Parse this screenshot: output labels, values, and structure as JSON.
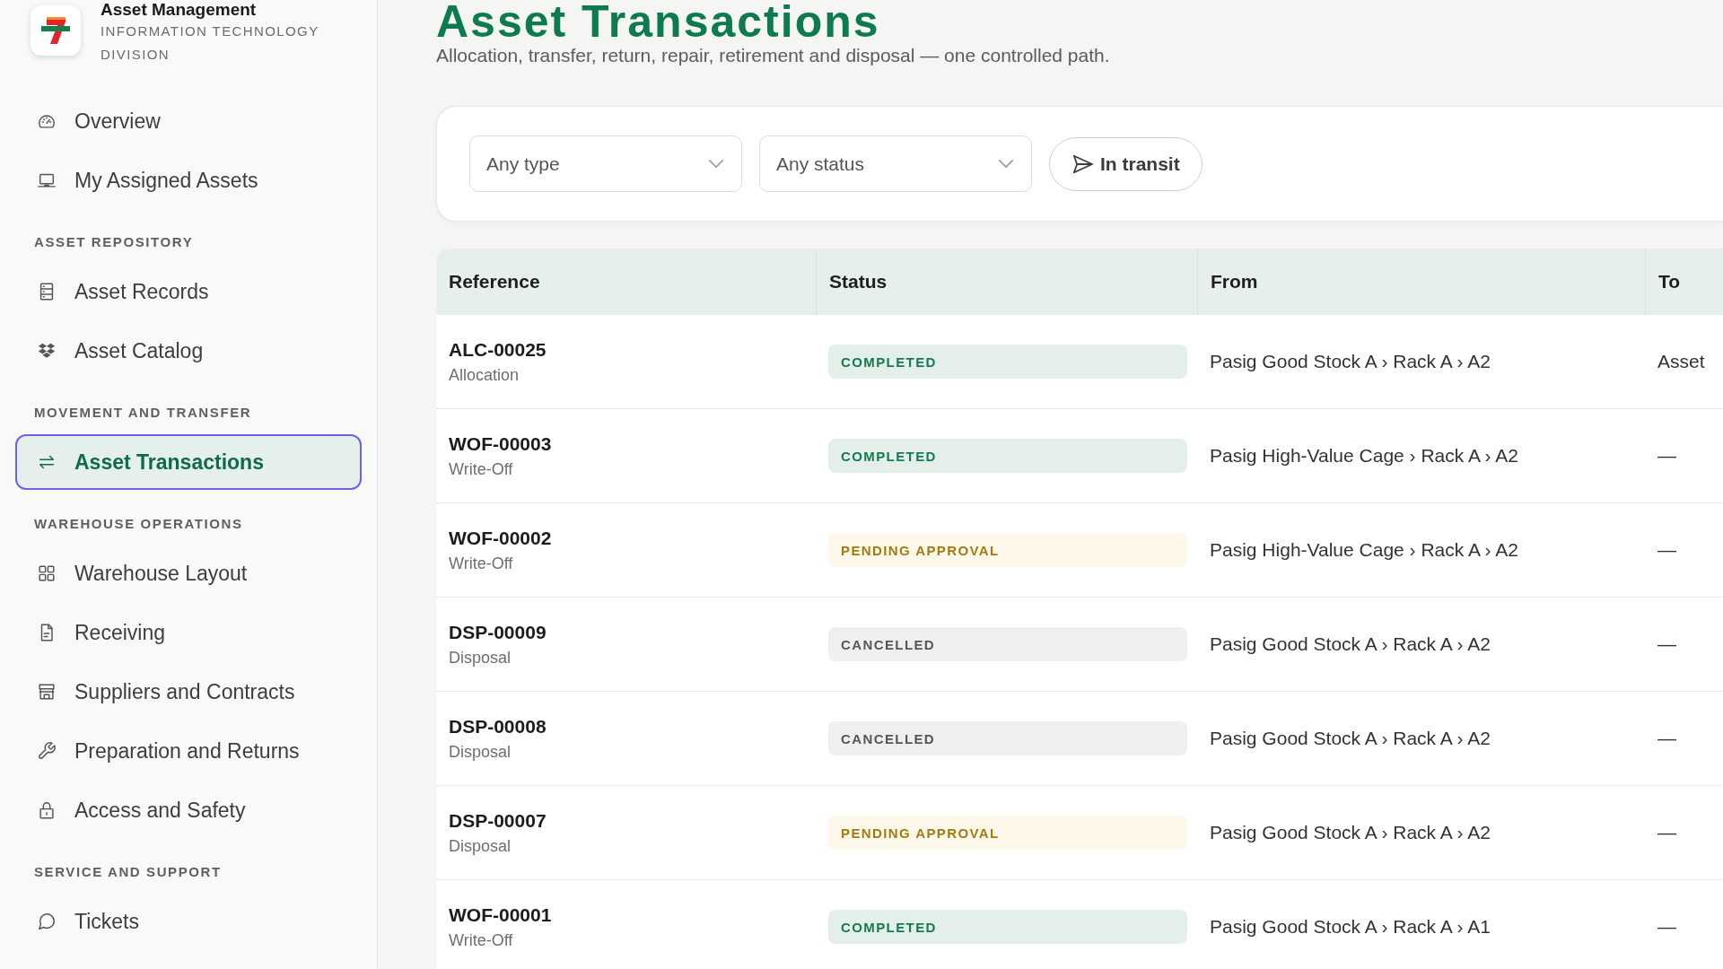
{
  "sidebar": {
    "brand": {
      "title": "Asset Management",
      "subtitle": "INFORMATION TECHNOLOGY DIVISION"
    },
    "items": [
      {
        "label": "Overview",
        "selected": false
      },
      {
        "label": "My Assigned Assets",
        "selected": false
      }
    ],
    "sections": [
      {
        "heading": "ASSET REPOSITORY",
        "items": [
          {
            "label": "Asset Records",
            "selected": false
          },
          {
            "label": "Asset Catalog",
            "selected": false
          }
        ]
      },
      {
        "heading": "MOVEMENT AND TRANSFER",
        "items": [
          {
            "label": "Asset Transactions",
            "selected": true
          }
        ]
      },
      {
        "heading": "WAREHOUSE OPERATIONS",
        "items": [
          {
            "label": "Warehouse Layout",
            "selected": false
          },
          {
            "label": "Receiving",
            "selected": false
          },
          {
            "label": "Suppliers and Contracts",
            "selected": false
          },
          {
            "label": "Preparation and Returns",
            "selected": false
          },
          {
            "label": "Access and Safety",
            "selected": false
          }
        ]
      },
      {
        "heading": "SERVICE AND SUPPORT",
        "items": [
          {
            "label": "Tickets",
            "selected": false
          }
        ]
      }
    ]
  },
  "page": {
    "title": "Asset Transactions",
    "subtitle": "Allocation, transfer, return, repair, retirement and disposal — one controlled path."
  },
  "filters": {
    "type_select": {
      "value": "Any type"
    },
    "status_select": {
      "value": "Any status"
    },
    "in_transit_button": "In transit"
  },
  "table": {
    "columns": [
      "Reference",
      "Status",
      "From",
      "To"
    ],
    "rows": [
      {
        "reference": "ALC-00025",
        "type": "Allocation",
        "status": {
          "label": "COMPLETED",
          "kind": "completed"
        },
        "from": "Pasig Good Stock A › Rack A › A2",
        "to": "Asset"
      },
      {
        "reference": "WOF-00003",
        "type": "Write-Off",
        "status": {
          "label": "COMPLETED",
          "kind": "completed"
        },
        "from": "Pasig High-Value Cage › Rack A › A2",
        "to": "—"
      },
      {
        "reference": "WOF-00002",
        "type": "Write-Off",
        "status": {
          "label": "PENDING APPROVAL",
          "kind": "pending"
        },
        "from": "Pasig High-Value Cage › Rack A › A2",
        "to": "—"
      },
      {
        "reference": "DSP-00009",
        "type": "Disposal",
        "status": {
          "label": "CANCELLED",
          "kind": "cancelled"
        },
        "from": "Pasig Good Stock A › Rack A › A2",
        "to": "—"
      },
      {
        "reference": "DSP-00008",
        "type": "Disposal",
        "status": {
          "label": "CANCELLED",
          "kind": "cancelled"
        },
        "from": "Pasig Good Stock A › Rack A › A2",
        "to": "—"
      },
      {
        "reference": "DSP-00007",
        "type": "Disposal",
        "status": {
          "label": "PENDING APPROVAL",
          "kind": "pending"
        },
        "from": "Pasig Good Stock A › Rack A › A2",
        "to": "—"
      },
      {
        "reference": "WOF-00001",
        "type": "Write-Off",
        "status": {
          "label": "COMPLETED",
          "kind": "completed"
        },
        "from": "Pasig Good Stock A › Rack A › A1",
        "to": "—"
      }
    ]
  }
}
